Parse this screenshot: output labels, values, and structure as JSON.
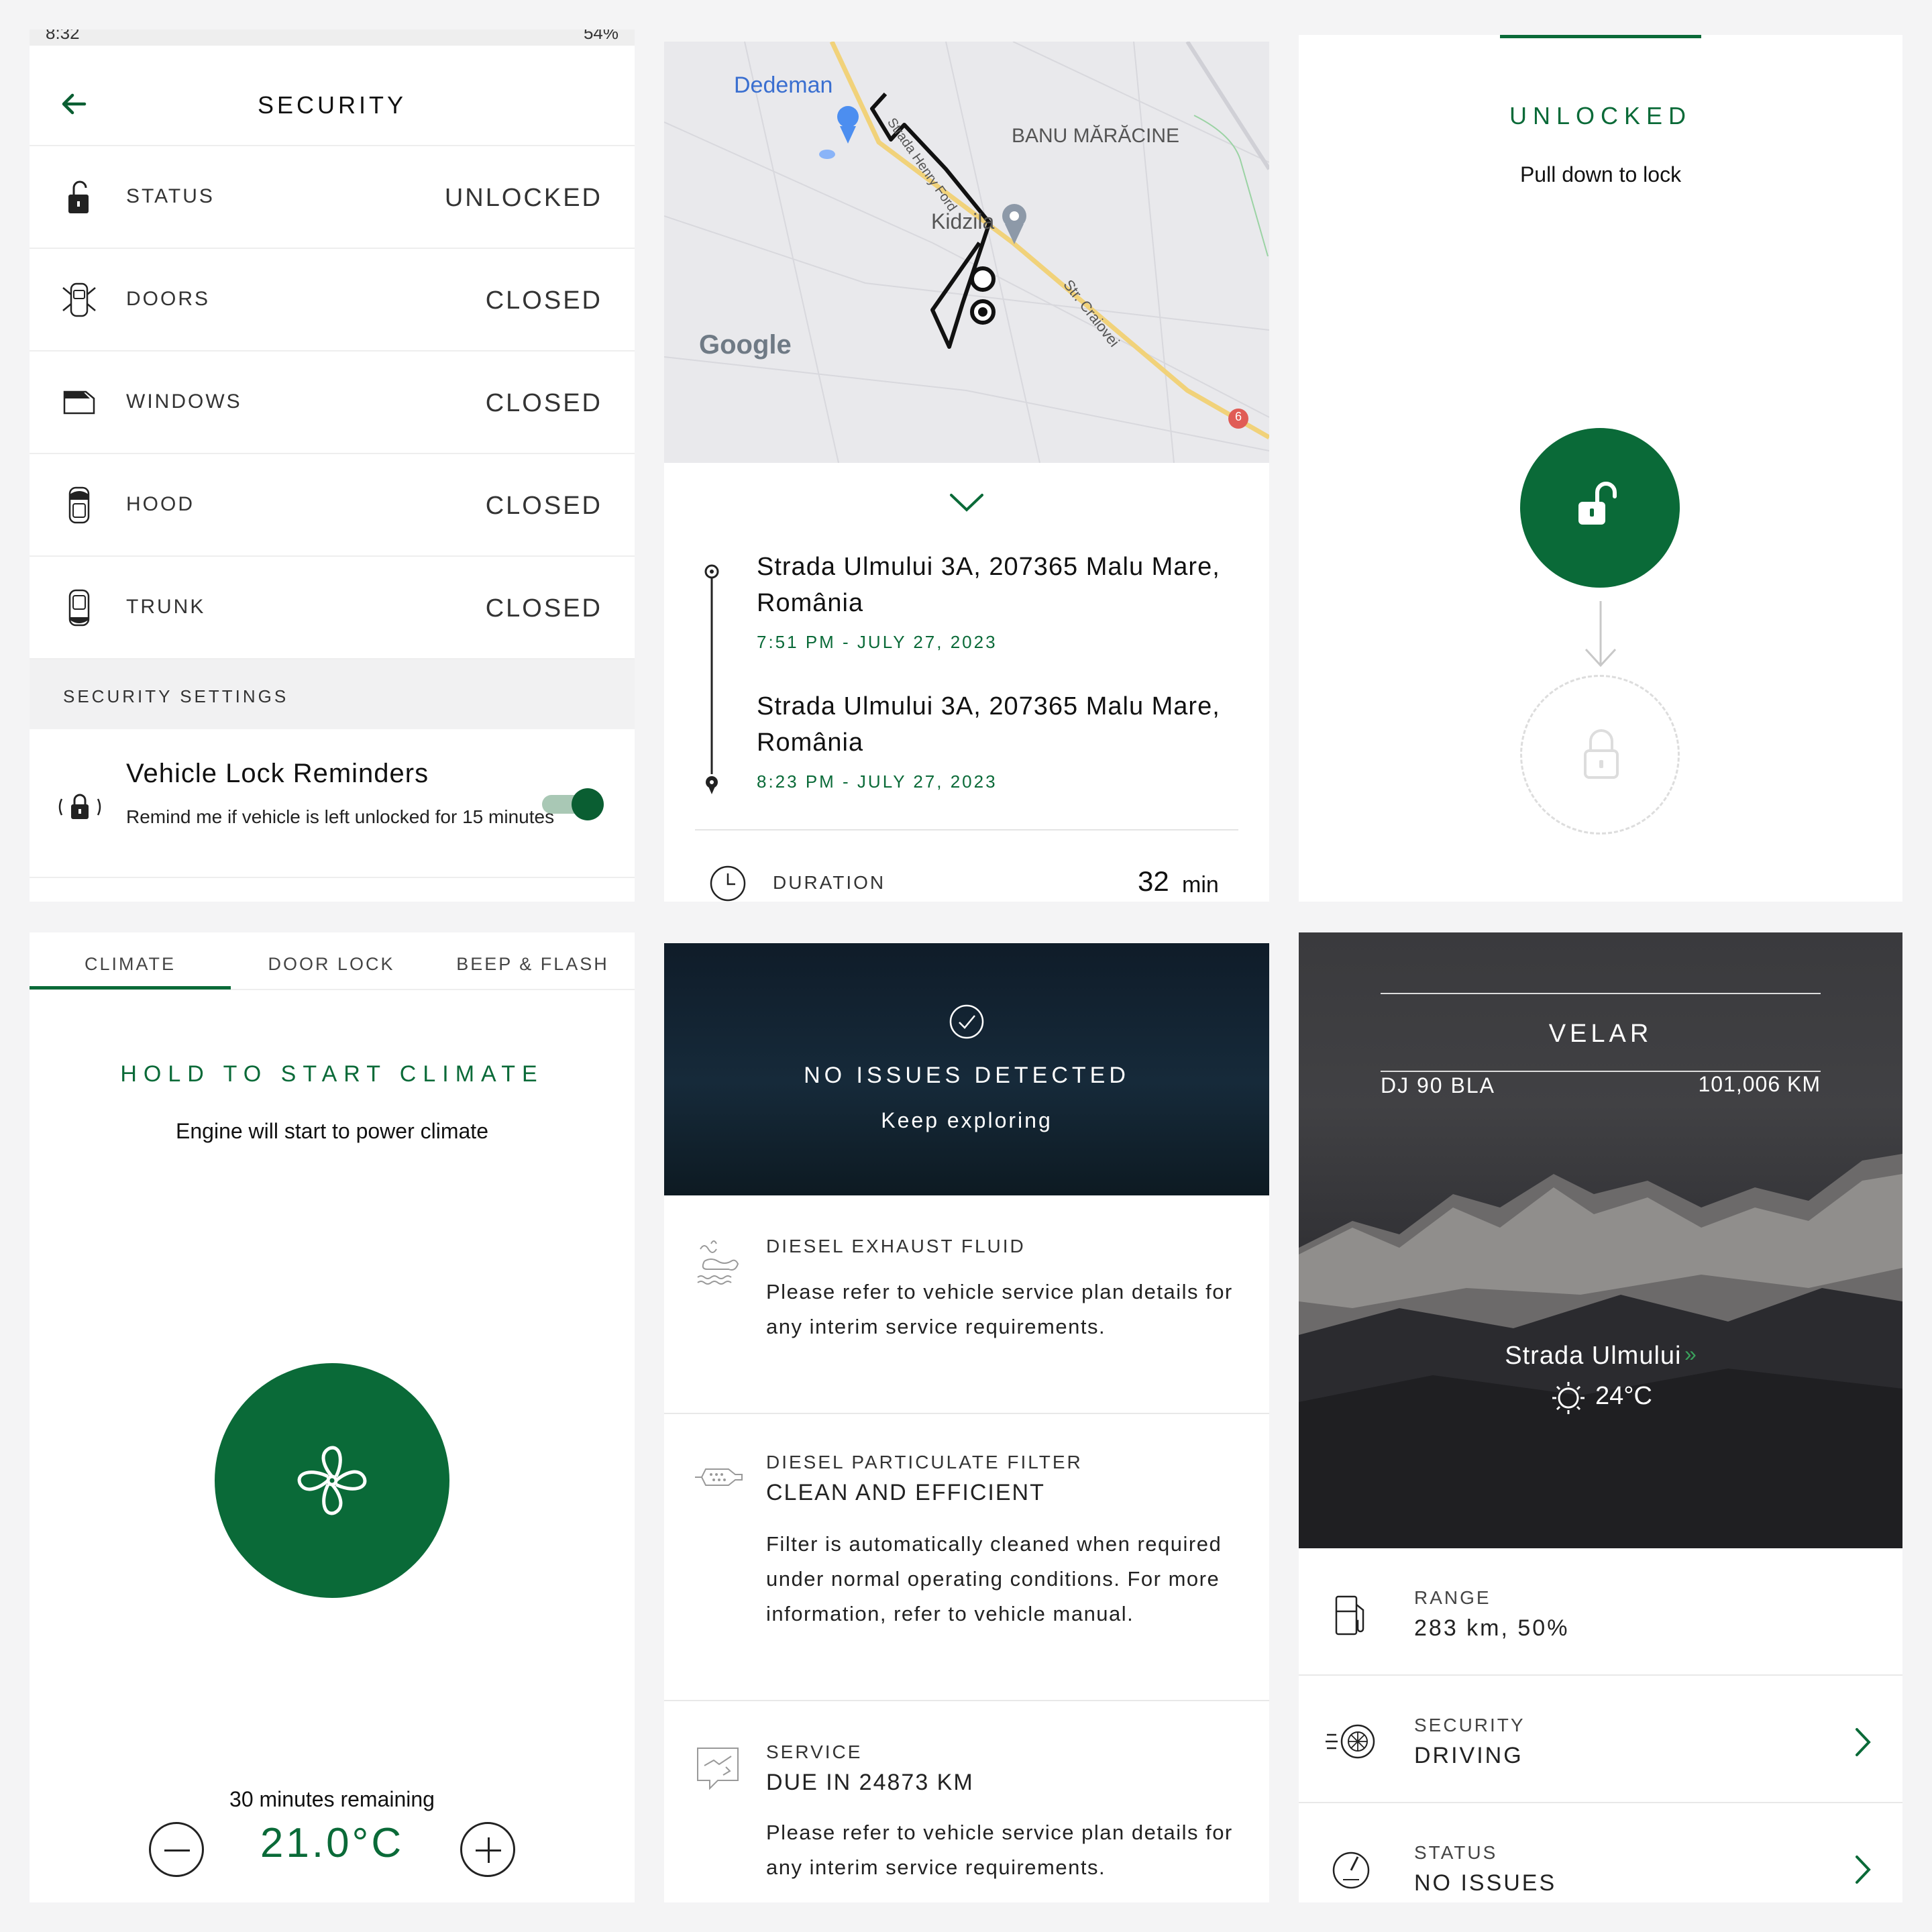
{
  "security": {
    "status_time": "8:32",
    "status_battery": "54%",
    "title": "SECURITY",
    "rows": [
      {
        "label": "STATUS",
        "value": "UNLOCKED"
      },
      {
        "label": "DOORS",
        "value": "CLOSED"
      },
      {
        "label": "WINDOWS",
        "value": "CLOSED"
      },
      {
        "label": "HOOD",
        "value": "CLOSED"
      },
      {
        "label": "TRUNK",
        "value": "CLOSED"
      }
    ],
    "settings_header": "SECURITY SETTINGS",
    "reminder_title": "Vehicle Lock Reminders",
    "reminder_desc": "Remind me if vehicle is left unlocked for 15 minutes",
    "reminder_enabled": true
  },
  "trip": {
    "map": {
      "poi_dedeman": "Dedeman",
      "area_banu": "BANU MĂRĂCINE",
      "poi_kidzila": "Kidzila",
      "street_henry_ford": "Strada Henry Ford",
      "street_craiovei": "Str. Craiovei",
      "route_shield": "6",
      "logo": "Google"
    },
    "start_address": "Strada Ulmului 3A, 207365 Malu Mare, România",
    "start_time": "7:51 PM - JULY 27, 2023",
    "end_address": "Strada Ulmului 3A, 207365 Malu Mare, România",
    "end_time": "8:23 PM - JULY 27, 2023",
    "duration_label": "DURATION",
    "duration_value": "32",
    "duration_unit": "min"
  },
  "lock": {
    "title": "UNLOCKED",
    "subtitle": "Pull down to lock"
  },
  "climate": {
    "tabs": [
      "CLIMATE",
      "DOOR LOCK",
      "BEEP & FLASH"
    ],
    "active_tab": 0,
    "title": "HOLD TO START CLIMATE",
    "subtitle": "Engine will start to power climate",
    "remaining": "30 minutes remaining",
    "temperature": "21.0°C"
  },
  "health": {
    "hero_title": "NO ISSUES DETECTED",
    "hero_sub": "Keep exploring",
    "items": [
      {
        "caption": "DIESEL EXHAUST FLUID",
        "heading": "",
        "body": "Please refer to vehicle service plan details for any interim service requirements."
      },
      {
        "caption": "DIESEL PARTICULATE FILTER",
        "heading": "CLEAN AND EFFICIENT",
        "body": "Filter is automatically cleaned when required under normal operating conditions. For more information, refer to vehicle manual."
      },
      {
        "caption": "SERVICE",
        "heading": "DUE IN 24873 KM",
        "body": "Please refer to vehicle service plan details for any interim service requirements."
      }
    ]
  },
  "vehicle": {
    "model": "VELAR",
    "plate": "DJ 90 BLA",
    "odometer": "101,006 KM",
    "location": "Strada Ulmului",
    "weather": "24°C",
    "list": [
      {
        "caption": "RANGE",
        "value": "283 km, 50%"
      },
      {
        "caption": "SECURITY",
        "value": "DRIVING"
      },
      {
        "caption": "STATUS",
        "value": "NO ISSUES"
      }
    ]
  },
  "colors": {
    "brand_green": "#0a6a38",
    "warning_gold": "#d09a18"
  }
}
